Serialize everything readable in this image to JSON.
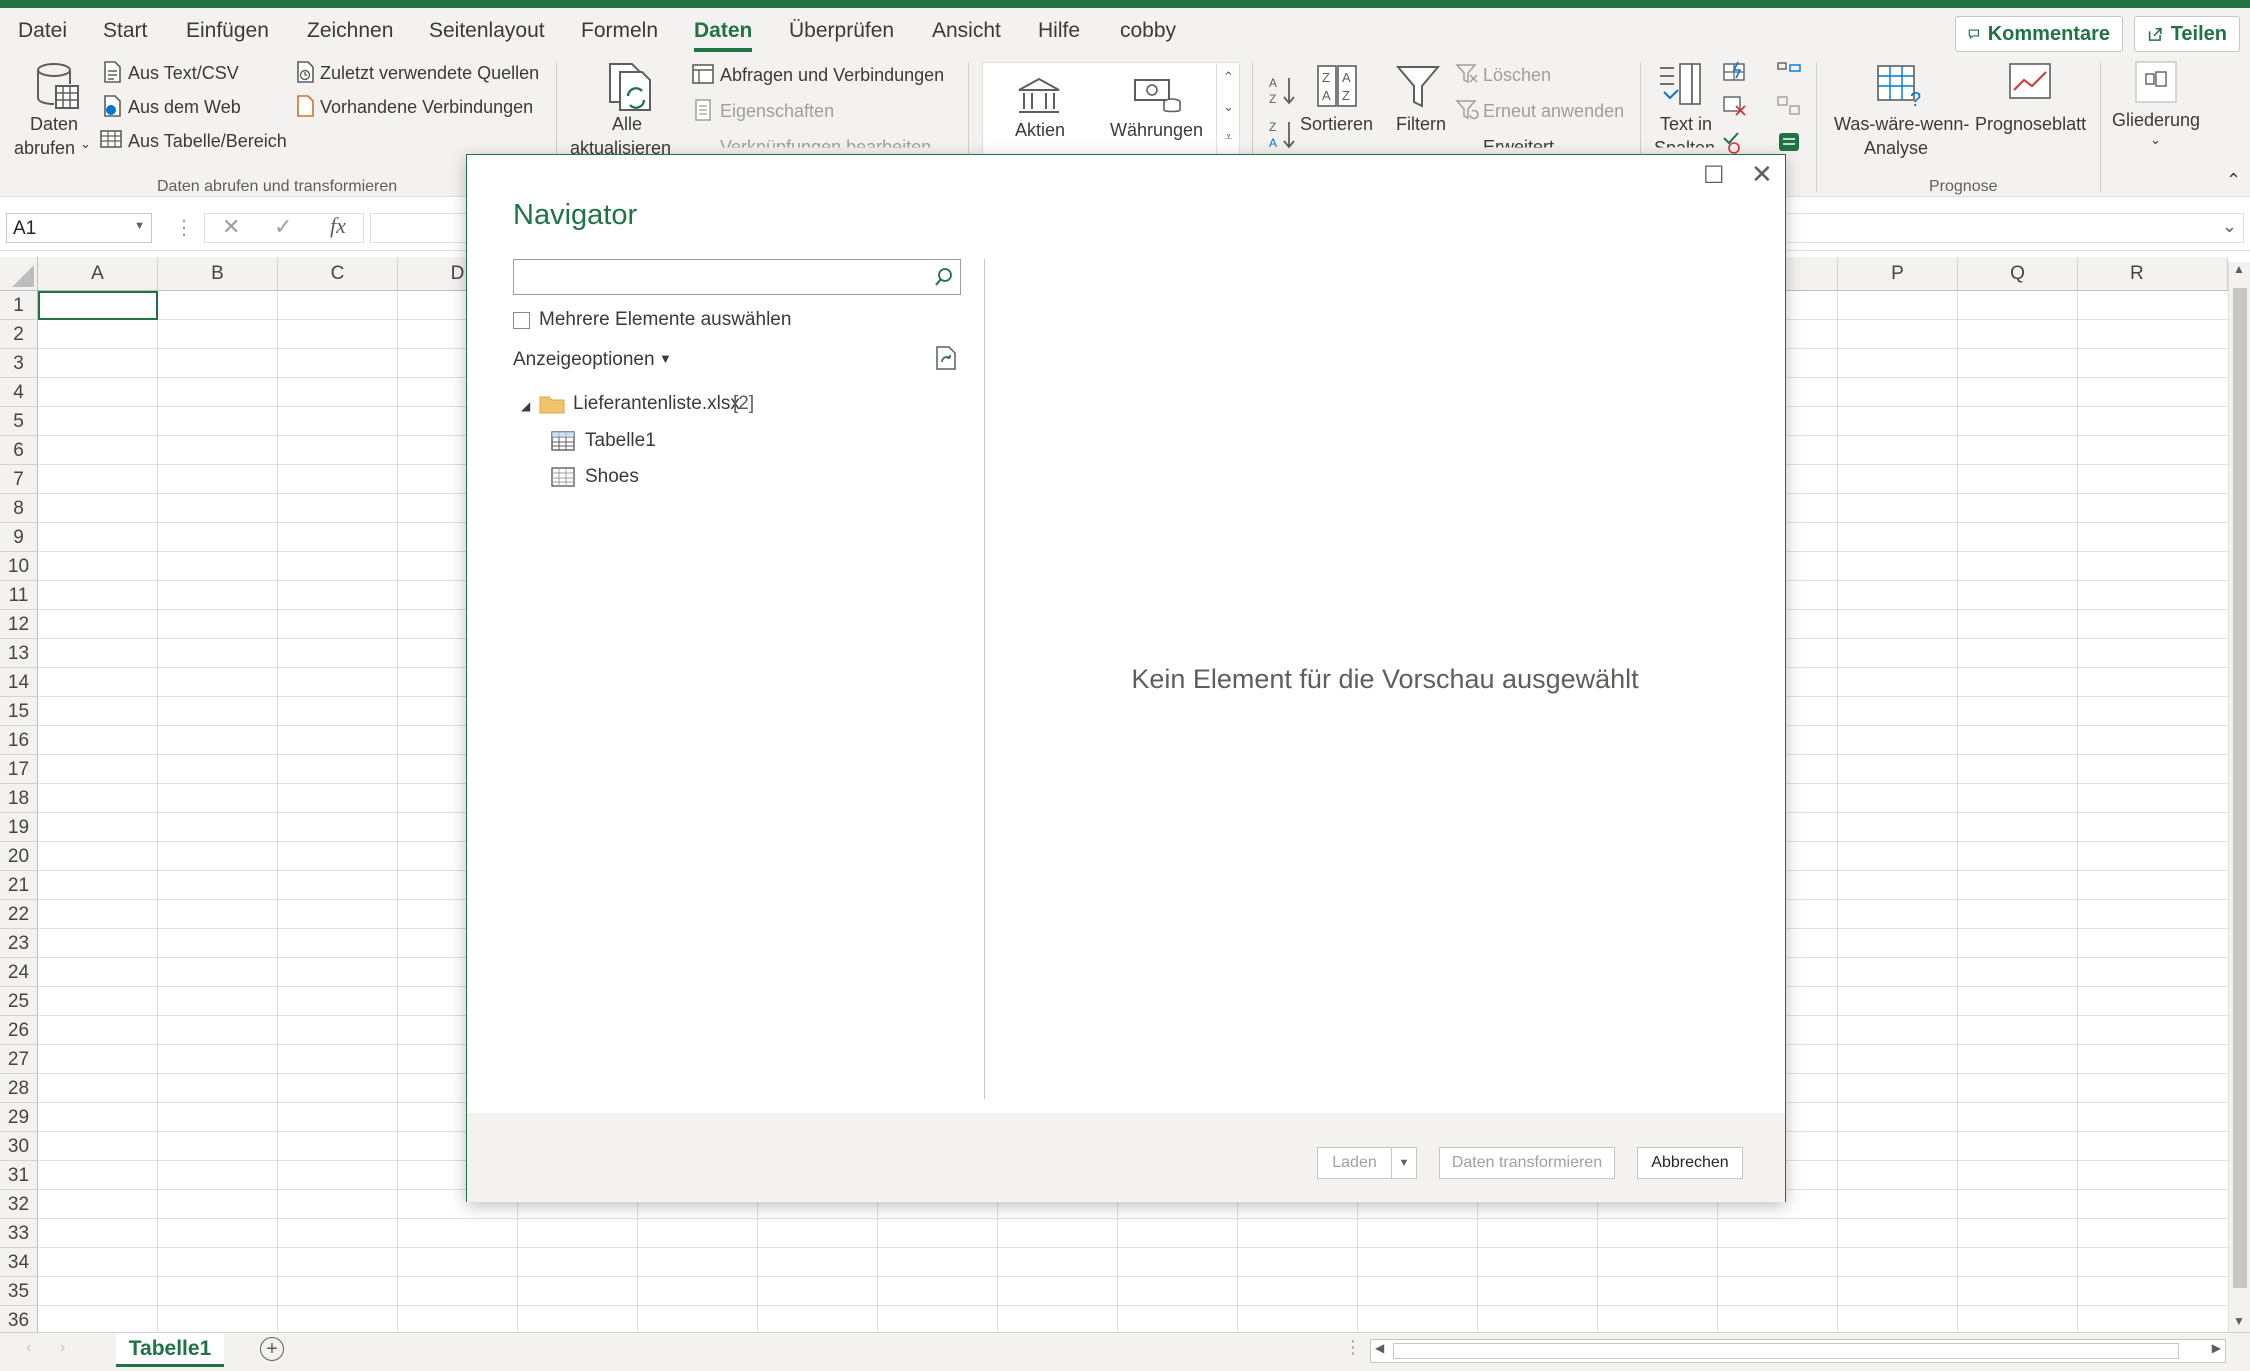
{
  "menu_tabs": [
    "Datei",
    "Start",
    "Einfügen",
    "Zeichnen",
    "Seitenlayout",
    "Formeln",
    "Daten",
    "Überprüfen",
    "Ansicht",
    "Hilfe",
    "cobby"
  ],
  "active_tab": "Daten",
  "top_buttons": {
    "comments": "Kommentare",
    "share": "Teilen"
  },
  "ribbon": {
    "get_data": {
      "line1": "Daten",
      "line2": "abrufen"
    },
    "from_text": "Aus Text/CSV",
    "from_web": "Aus dem Web",
    "from_table": "Aus Tabelle/Bereich",
    "recent_sources": "Zuletzt verwendete Quellen",
    "existing_connections": "Vorhandene Verbindungen",
    "group_get_transform": "Daten abrufen und transformieren",
    "refresh_all": {
      "line1": "Alle",
      "line2": "aktualisieren"
    },
    "queries_connections": "Abfragen und Verbindungen",
    "properties": "Eigenschaften",
    "edit_links": "Verknüpfungen bearbeiten",
    "stocks": "Aktien",
    "currencies": "Währungen",
    "sort": "Sortieren",
    "filter": "Filtern",
    "clear": "Löschen",
    "reapply": "Erneut anwenden",
    "advanced": "Erweitert",
    "text_to_columns": {
      "line1": "Text in",
      "line2": "Spalten"
    },
    "what_if": {
      "line1": "Was-wäre-wenn-",
      "line2": "Analyse"
    },
    "forecast_sheet": "Prognoseblatt",
    "group_forecast": "Prognose",
    "outline": "Gliederung"
  },
  "formula_bar": {
    "name_box": "A1",
    "fx": "fx",
    "value": ""
  },
  "columns": [
    "A",
    "B",
    "C",
    "D",
    "P",
    "Q",
    "R"
  ],
  "rows": [
    "1",
    "2",
    "3",
    "4",
    "5",
    "6",
    "7",
    "8",
    "9",
    "10",
    "11",
    "12",
    "13",
    "14",
    "15",
    "16",
    "17",
    "18",
    "19",
    "20",
    "21",
    "22",
    "23",
    "24",
    "25",
    "26",
    "27",
    "28",
    "29",
    "30",
    "31",
    "32",
    "33",
    "34",
    "35",
    "36"
  ],
  "sheet_tab": "Tabelle1",
  "navigator": {
    "title": "Navigator",
    "search_placeholder": "",
    "multi_select_label": "Mehrere Elemente auswählen",
    "display_options": "Anzeigeoptionen",
    "file_name": "Lieferantenliste.xlsx",
    "file_count": "[2]",
    "items": [
      "Tabelle1",
      "Shoes"
    ],
    "preview_empty": "Kein Element für die Vorschau ausgewählt",
    "load": "Laden",
    "transform": "Daten transformieren",
    "cancel": "Abbrechen"
  }
}
